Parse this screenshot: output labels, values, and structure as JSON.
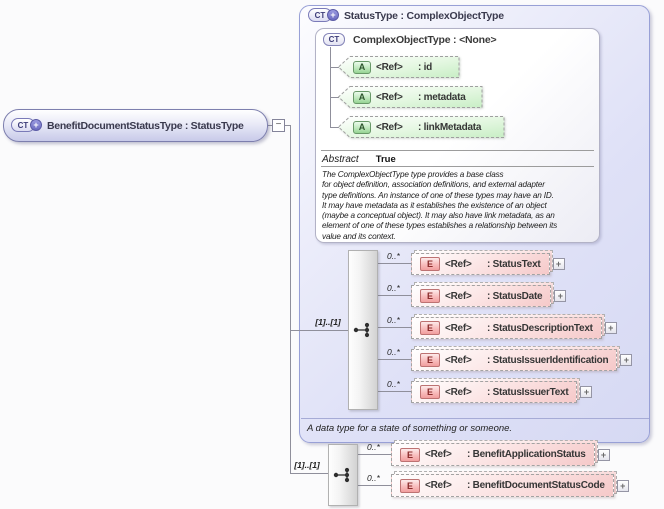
{
  "colors": {
    "container_fill": "#dfe1f7",
    "container_border": "#98a0d6",
    "attribute_fill": "#c8eec5",
    "element_fill": "#f5c9c9",
    "line": "#8f8f9b"
  },
  "icons": {
    "complex_type": "CT",
    "complex_type_plus": "+",
    "attribute": "A",
    "element": "E",
    "collapse": "−",
    "expand": "+"
  },
  "root_element": {
    "label": "BenefitDocumentStatusType : StatusType"
  },
  "status_type": {
    "title": "StatusType : ComplexObjectType",
    "footnote": "A data type for a state of something or someone.",
    "base": {
      "title": "ComplexObjectType : <None>",
      "attributes": [
        {
          "ref": "<Ref>",
          "name": ": id"
        },
        {
          "ref": "<Ref>",
          "name": ": metadata"
        },
        {
          "ref": "<Ref>",
          "name": ": linkMetadata"
        }
      ],
      "abstract_label": "Abstract",
      "abstract_value": "True",
      "description": "The ComplexObjectType type provides a base class\nfor object definition, association definitions, and external adapter\ntype definitions. An instance of one of these types may have an ID.\nIt may have metadata as it establishes the existence of an object\n(maybe a conceptual object). It may also have link metadata, as an\nelement of one of these types establishes a relationship between its\nvalue and its context."
    },
    "sequence": {
      "occurrence": "[1]..[1]",
      "elements": [
        {
          "occurrence": "0..*",
          "ref": "<Ref>",
          "name": ": StatusText"
        },
        {
          "occurrence": "0..*",
          "ref": "<Ref>",
          "name": ": StatusDate"
        },
        {
          "occurrence": "0..*",
          "ref": "<Ref>",
          "name": ": StatusDescriptionText"
        },
        {
          "occurrence": "0..*",
          "ref": "<Ref>",
          "name": ": StatusIssuerIdentification"
        },
        {
          "occurrence": "0..*",
          "ref": "<Ref>",
          "name": ": StatusIssuerText"
        }
      ]
    }
  },
  "root_sequence": {
    "occurrence": "[1]..[1]",
    "elements": [
      {
        "occurrence": "0..*",
        "ref": "<Ref>",
        "name": ": BenefitApplicationStatus"
      },
      {
        "occurrence": "0..*",
        "ref": "<Ref>",
        "name": ": BenefitDocumentStatusCode"
      }
    ]
  }
}
